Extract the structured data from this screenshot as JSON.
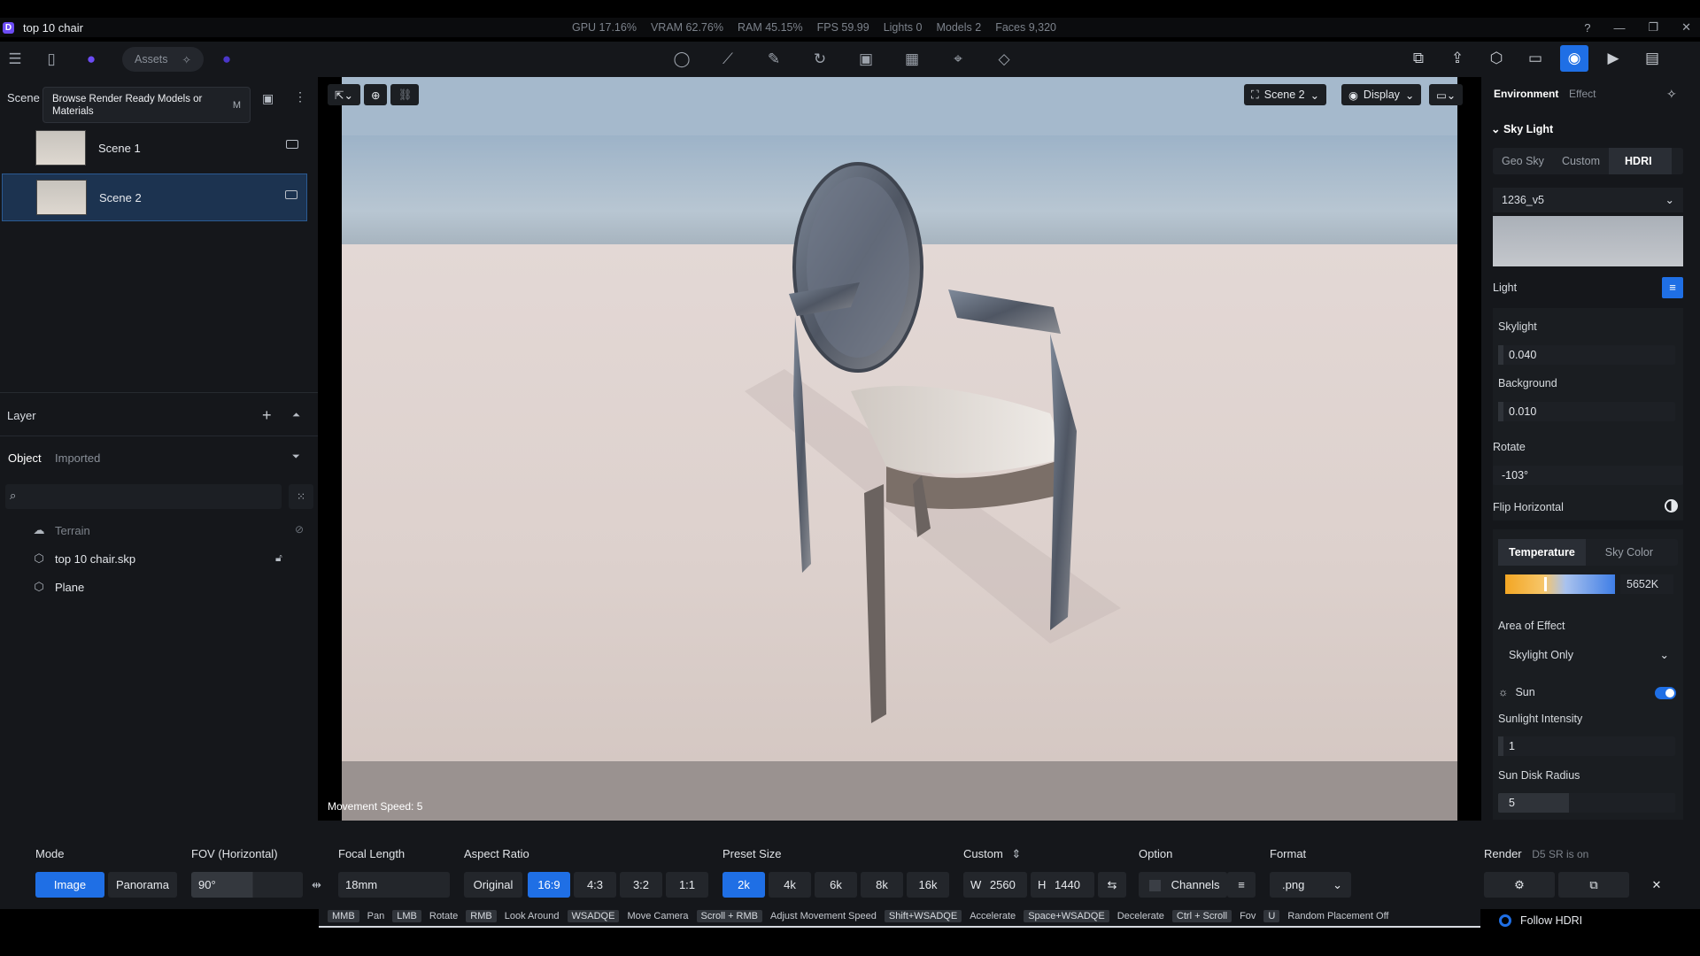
{
  "app": {
    "title": "top 10 chair"
  },
  "stats": [
    "GPU 17.16%",
    "VRAM 62.76%",
    "RAM 45.15%",
    "FPS 59.99",
    "Lights 0",
    "Models 2",
    "Faces 9,320"
  ],
  "toolbar": {
    "assets_label": "Assets"
  },
  "scene_panel": {
    "title": "Scene",
    "tooltip": "Browse Render Ready Models or Materials",
    "tooltip_key": "M",
    "scenes": [
      {
        "name": "Scene 1"
      },
      {
        "name": "Scene 2"
      }
    ]
  },
  "layer_panel": {
    "title": "Layer"
  },
  "object_panel": {
    "tabs": [
      "Object",
      "Imported"
    ],
    "items": [
      {
        "name": "Terrain"
      },
      {
        "name": "top 10 chair.skp"
      },
      {
        "name": "Plane"
      }
    ]
  },
  "viewport": {
    "scene_label": "Scene 2",
    "display_label": "Display",
    "movement_speed": "Movement Speed: 5"
  },
  "right_panel": {
    "tabs": [
      "Environment",
      "Effect"
    ],
    "sky_light": "Sky Light",
    "sky_modes": [
      "Geo Sky",
      "Custom",
      "HDRI"
    ],
    "hdri_name": "1236_v5",
    "light_label": "Light",
    "skylight_label": "Skylight",
    "skylight_value": "0.040",
    "background_label": "Background",
    "background_value": "0.010",
    "rotate_label": "Rotate",
    "rotate_value": "-103°",
    "flip_label": "Flip Horizontal",
    "color_modes": [
      "Temperature",
      "Sky Color"
    ],
    "temperature": "5652K",
    "area_label": "Area of Effect",
    "area_value": "Skylight Only",
    "sun_label": "Sun",
    "sun_intensity_label": "Sunlight Intensity",
    "sun_intensity_value": "1",
    "sun_disk_label": "Sun Disk Radius",
    "sun_disk_value": "5",
    "follow_hdri": "Follow HDRI"
  },
  "bottom": {
    "mode_label": "Mode",
    "modes": [
      "Image",
      "Panorama"
    ],
    "fov_label": "FOV (Horizontal)",
    "fov_value": "90°",
    "focal_label": "Focal Length",
    "focal_value": "18mm",
    "aspect_label": "Aspect Ratio",
    "aspects": [
      "Original",
      "16:9",
      "4:3",
      "3:2",
      "1:1"
    ],
    "preset_label": "Preset Size",
    "presets": [
      "2k",
      "4k",
      "6k",
      "8k",
      "16k"
    ],
    "custom_label": "Custom",
    "w_label": "W",
    "w_value": "2560",
    "h_label": "H",
    "h_value": "1440",
    "option_label": "Option",
    "channels_label": "Channels",
    "format_label": "Format",
    "format_value": ".png",
    "render_label": "Render",
    "render_note": "D5 SR is on"
  },
  "shortcuts": [
    {
      "key": "MMB",
      "action": "Pan"
    },
    {
      "key": "LMB",
      "action": "Rotate"
    },
    {
      "key": "RMB",
      "action": "Look Around"
    },
    {
      "key": "WSADQE",
      "action": "Move Camera"
    },
    {
      "key": "Scroll + RMB",
      "action": "Adjust Movement Speed"
    },
    {
      "key": "Shift+WSADQE",
      "action": "Accelerate"
    },
    {
      "key": "Space+WSADQE",
      "action": "Decelerate"
    },
    {
      "key": "Ctrl + Scroll",
      "action": "Fov"
    },
    {
      "key": "U",
      "action": "Random Placement Off"
    }
  ]
}
